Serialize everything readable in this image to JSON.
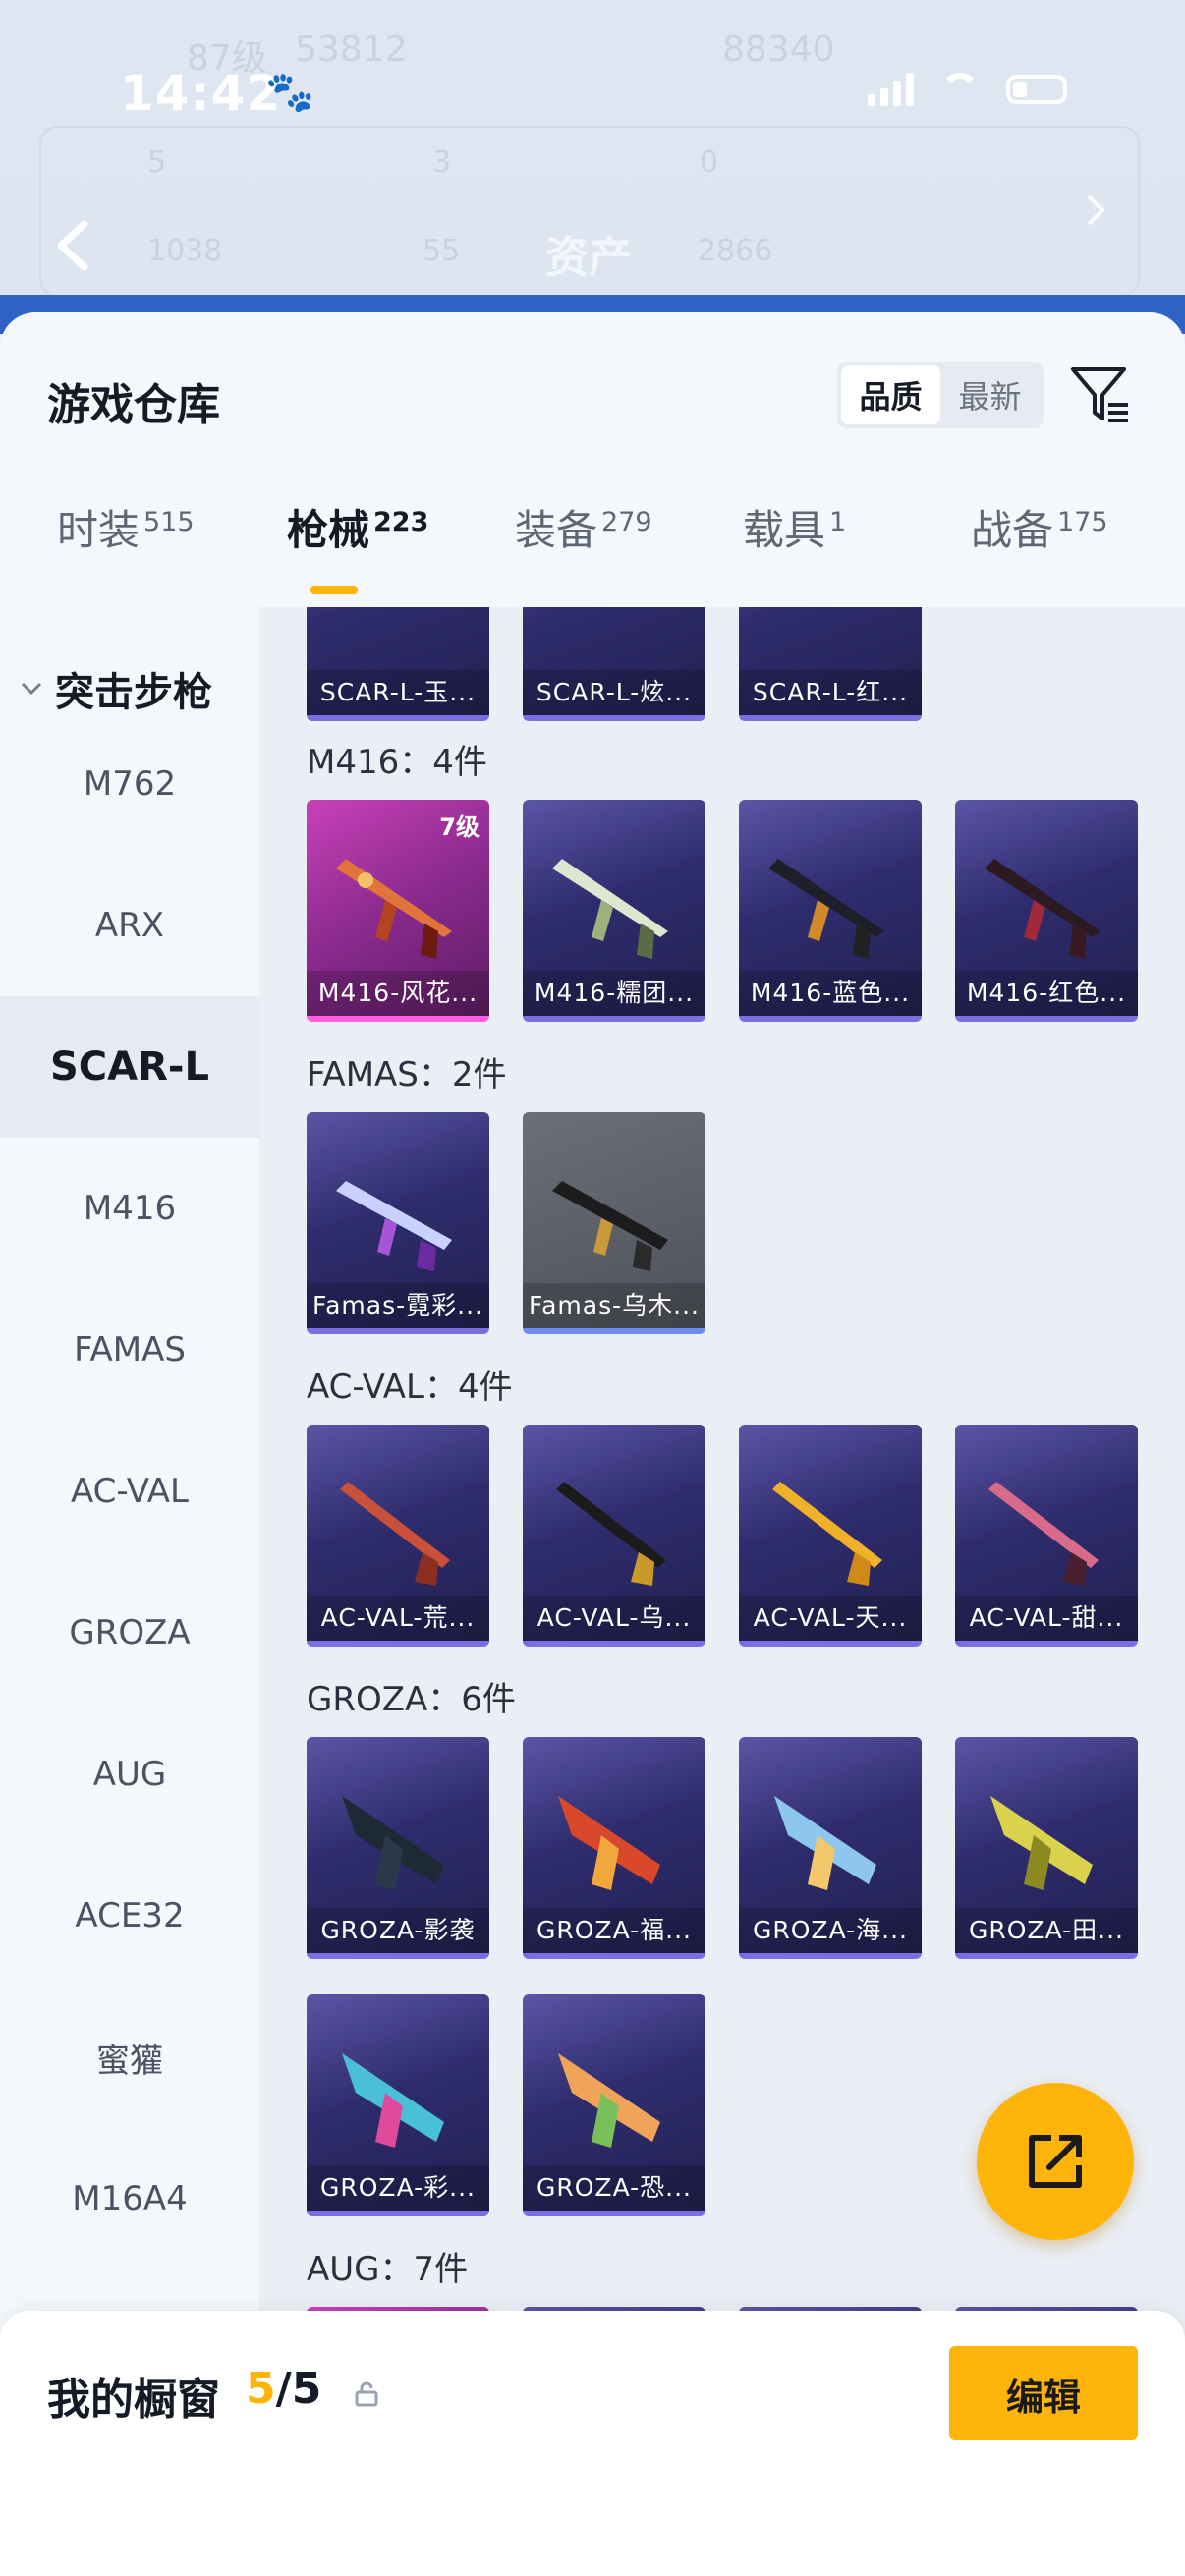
{
  "status_bar": {
    "time": "14:42"
  },
  "background_header": {
    "title": "资产",
    "ghost_level": "87级",
    "ghost_num1": "53812",
    "ghost_num2": "88340",
    "ghost_a": "5",
    "ghost_b": "3",
    "ghost_c": "0",
    "ghost_d": "1038",
    "ghost_e": "55",
    "ghost_f": "2866"
  },
  "warehouse": {
    "title": "游戏仓库",
    "sort_options": [
      {
        "label": "品质",
        "active": true
      },
      {
        "label": "最新",
        "active": false
      }
    ],
    "filter_icon": "filter-icon"
  },
  "tabs": [
    {
      "label": "时装",
      "count": "515",
      "active": false
    },
    {
      "label": "枪械",
      "count": "223",
      "active": true
    },
    {
      "label": "装备",
      "count": "279",
      "active": false
    },
    {
      "label": "载具",
      "count": "1",
      "active": false
    },
    {
      "label": "战备",
      "count": "175",
      "active": false
    }
  ],
  "sidebar": {
    "group": "突击步枪",
    "items": [
      "M762",
      "ARX",
      "SCAR-L",
      "M416",
      "FAMAS",
      "AC-VAL",
      "GROZA",
      "AUG",
      "ACE32",
      "蜜獾",
      "M16A4"
    ],
    "active": "SCAR-L"
  },
  "content": {
    "top_partial": [
      "SCAR-L-玉...",
      "SCAR-L-炫...",
      "SCAR-L-红..."
    ],
    "sections": [
      {
        "label": "M416：4件",
        "items": [
          {
            "name": "M416-风花...",
            "level": "7级",
            "quality": "pink"
          },
          {
            "name": "M416-糯团...",
            "quality": "purple"
          },
          {
            "name": "M416-蓝色...",
            "quality": "purple"
          },
          {
            "name": "M416-红色...",
            "quality": "purple"
          }
        ]
      },
      {
        "label": "FAMAS：2件",
        "items": [
          {
            "name": "Famas-霓彩...",
            "quality": "purple"
          },
          {
            "name": "Famas-乌木...",
            "quality": "grey"
          }
        ]
      },
      {
        "label": "AC-VAL：4件",
        "items": [
          {
            "name": "AC-VAL-荒...",
            "quality": "purple"
          },
          {
            "name": "AC-VAL-乌...",
            "quality": "purple"
          },
          {
            "name": "AC-VAL-天...",
            "quality": "purple"
          },
          {
            "name": "AC-VAL-甜...",
            "quality": "purple"
          }
        ]
      },
      {
        "label": "GROZA：6件",
        "items": [
          {
            "name": "GROZA-影袭",
            "quality": "purple"
          },
          {
            "name": "GROZA-福...",
            "quality": "purple"
          },
          {
            "name": "GROZA-海...",
            "quality": "purple"
          },
          {
            "name": "GROZA-田...",
            "quality": "purple"
          },
          {
            "name": "GROZA-彩...",
            "quality": "purple"
          },
          {
            "name": "GROZA-恐...",
            "quality": "purple"
          }
        ]
      },
      {
        "label": "AUG：7件",
        "items": []
      }
    ]
  },
  "fab": {
    "icon": "share-icon"
  },
  "showcase": {
    "label": "我的橱窗",
    "current": "5",
    "total": "/5",
    "edit_label": "编辑"
  },
  "colors": {
    "accent": "#ffb40a",
    "purple_item": "#2f2c6e",
    "pink_item": "#c941b8"
  }
}
